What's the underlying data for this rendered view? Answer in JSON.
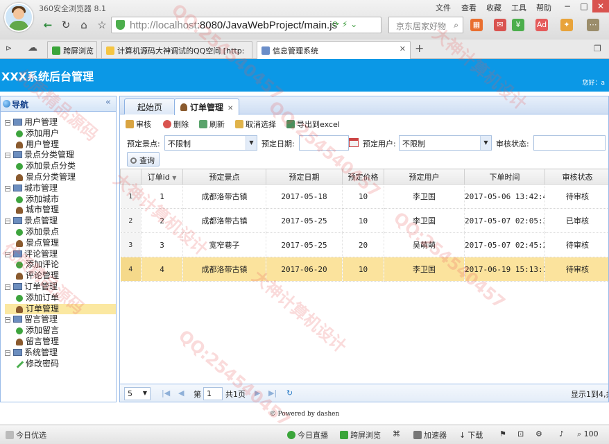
{
  "browser": {
    "name": "360安全浏览器 8.1",
    "menu": [
      "文件",
      "查看",
      "收藏",
      "工具",
      "帮助"
    ],
    "window_controls": [
      "−",
      "□",
      "✕"
    ],
    "url_host": "http://localhost",
    "url_rest": ":8080/JavaWebProject/main.js",
    "search_placeholder": "京东居家好物",
    "tabs": [
      {
        "label": "跨屏浏览"
      },
      {
        "label": "计算机源码大神调试的QQ空间 [http:"
      },
      {
        "label": "信息管理系统"
      }
    ],
    "new_tab": "+"
  },
  "app": {
    "title": "XXX系统后台管理",
    "greeting": "您好：a"
  },
  "nav": {
    "title": "导航",
    "collapse": "«",
    "groups": [
      {
        "label": "用户管理",
        "children": [
          "添加用户",
          "用户管理"
        ]
      },
      {
        "label": "景点分类管理",
        "children": [
          "添加景点分类",
          "景点分类管理"
        ]
      },
      {
        "label": "城市管理",
        "children": [
          "添加城市",
          "城市管理"
        ]
      },
      {
        "label": "景点管理",
        "children": [
          "添加景点",
          "景点管理"
        ]
      },
      {
        "label": "评论管理",
        "children": [
          "添加评论",
          "评论管理"
        ]
      },
      {
        "label": "订单管理",
        "children": [
          "添加订单",
          "订单管理"
        ]
      },
      {
        "label": "留言管理",
        "children": [
          "添加留言",
          "留言管理"
        ]
      },
      {
        "label": "系统管理",
        "children": [
          "修改密码"
        ]
      }
    ],
    "selected": "订单管理"
  },
  "main": {
    "tabs": [
      "起始页",
      "订单管理"
    ],
    "toolbar": {
      "audit": "审核",
      "delete": "删除",
      "refresh": "刷新",
      "deselect": "取消选择",
      "export": "导出到excel"
    },
    "filters": {
      "spot_label": "预定景点:",
      "spot_value": "不限制",
      "date_label": "预定日期:",
      "date_value": "",
      "user_label": "预定用户:",
      "user_value": "不限制",
      "status_label": "审核状态:",
      "status_value": "",
      "query": "查询"
    },
    "grid": {
      "columns": [
        "订单id",
        "预定景点",
        "预定日期",
        "预定价格",
        "预定用户",
        "下单时间",
        "审核状态"
      ],
      "rows": [
        {
          "n": "1",
          "id": "1",
          "spot": "成都洛带古镇",
          "date": "2017-05-18",
          "price": "10",
          "user": "李卫国",
          "time": "2017-05-06 13:42:4",
          "status": "待审核"
        },
        {
          "n": "2",
          "id": "2",
          "spot": "成都洛带古镇",
          "date": "2017-05-25",
          "price": "10",
          "user": "李卫国",
          "time": "2017-05-07 02:05:3",
          "status": "已审核"
        },
        {
          "n": "3",
          "id": "3",
          "spot": "宽窄巷子",
          "date": "2017-05-25",
          "price": "20",
          "user": "吴萌萌",
          "time": "2017-05-07 02:45:2",
          "status": "待审核"
        },
        {
          "n": "4",
          "id": "4",
          "spot": "成都洛带古镇",
          "date": "2017-06-20",
          "price": "10",
          "user": "李卫国",
          "time": "2017-06-19 15:13:1",
          "status": "待审核"
        }
      ],
      "selected_row": 4
    },
    "pager": {
      "page_size": "5",
      "page_label": "第",
      "page_num": "1",
      "total_label": "共1页",
      "summary": "显示1到4,共"
    }
  },
  "footer": "© Powered by dashen",
  "statusbar": {
    "left": "今日优选",
    "items": [
      "今日直播",
      "跨屏浏览",
      "加速器",
      "下载"
    ],
    "zoom": "100"
  },
  "watermarks": [
    "QQ:254540457",
    "大神计算机设计",
    "优质精品源码",
    "QQ:254540457",
    "大神计算机设计",
    "优质精品源码",
    "QQ:254540457",
    "大神计算机设计",
    "QQ:254540457"
  ]
}
